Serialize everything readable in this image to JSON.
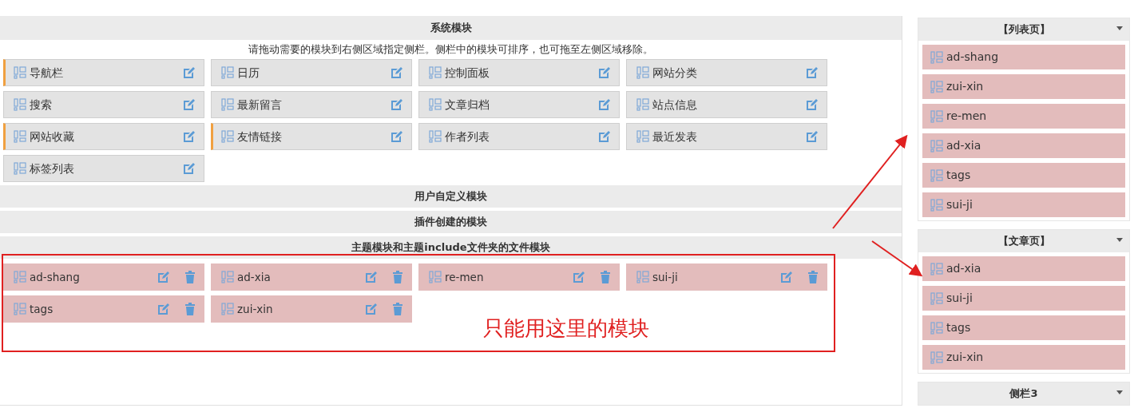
{
  "system_modules": {
    "title": "系统模块",
    "hint": "请拖动需要的模块到右侧区域指定侧栏。侧栏中的模块可排序，也可拖至左侧区域移除。",
    "modules": [
      {
        "label": "导航栏",
        "marked": true
      },
      {
        "label": "日历",
        "marked": false
      },
      {
        "label": "控制面板",
        "marked": false
      },
      {
        "label": "网站分类",
        "marked": false
      },
      {
        "label": "搜索",
        "marked": false
      },
      {
        "label": "最新留言",
        "marked": false
      },
      {
        "label": "文章归档",
        "marked": false
      },
      {
        "label": "站点信息",
        "marked": false
      },
      {
        "label": "网站收藏",
        "marked": true
      },
      {
        "label": "友情链接",
        "marked": true
      },
      {
        "label": "作者列表",
        "marked": false
      },
      {
        "label": "最近发表",
        "marked": false
      },
      {
        "label": "标签列表",
        "marked": false
      }
    ]
  },
  "sections": [
    {
      "title": "用户自定义模块"
    },
    {
      "title": "插件创建的模块"
    }
  ],
  "theme_modules": {
    "title": "主题模块和主题include文件夹的文件模块",
    "modules": [
      {
        "label": "ad-shang"
      },
      {
        "label": "ad-xia"
      },
      {
        "label": "re-men"
      },
      {
        "label": "sui-ji"
      },
      {
        "label": "tags"
      },
      {
        "label": "zui-xin"
      }
    ]
  },
  "annotation": {
    "text": "只能用这里的模块"
  },
  "sidebars": [
    {
      "title": "【列表页】",
      "modules": [
        {
          "label": "ad-shang"
        },
        {
          "label": "zui-xin"
        },
        {
          "label": "re-men"
        },
        {
          "label": "ad-xia"
        },
        {
          "label": "tags"
        },
        {
          "label": "sui-ji"
        }
      ]
    },
    {
      "title": "【文章页】",
      "modules": [
        {
          "label": "ad-xia"
        },
        {
          "label": "sui-ji"
        },
        {
          "label": "tags"
        },
        {
          "label": "zui-xin"
        }
      ]
    },
    {
      "title": "侧栏3"
    }
  ]
}
